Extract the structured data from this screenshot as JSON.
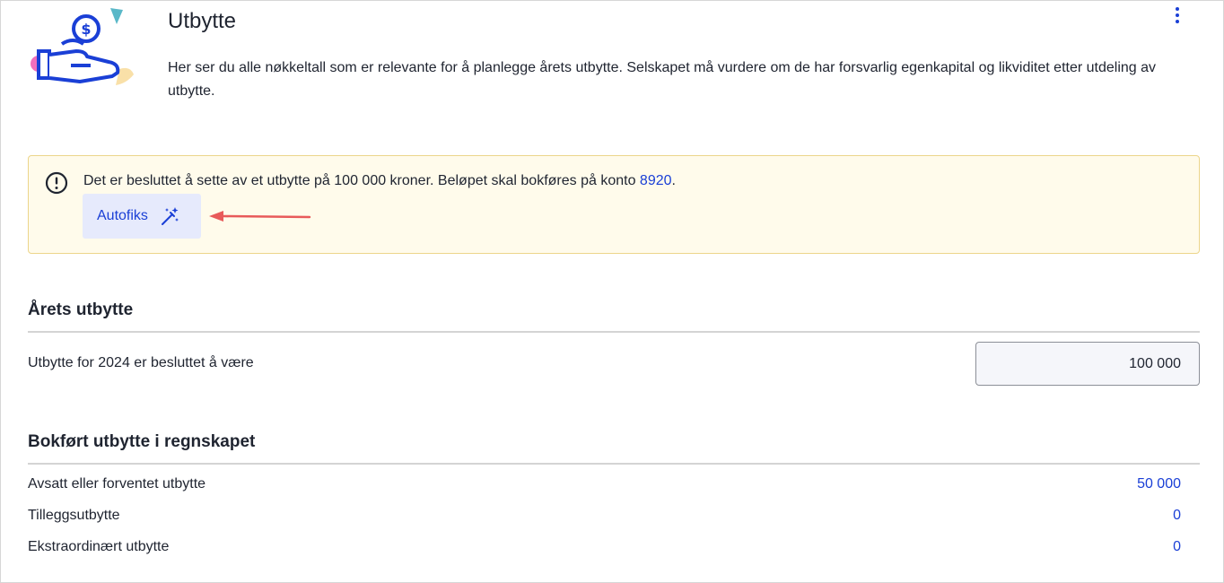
{
  "header": {
    "title": "Utbytte",
    "description": "Her ser du alle nøkkeltall som er relevante for å planlegge årets utbytte. Selskapet må vurdere om de har forsvarlig egenkapital og likviditet etter utdeling av utbytte."
  },
  "alert": {
    "text": "Det er besluttet å sette av et utbytte på 100 000 kroner. Beløpet skal bokføres på konto ",
    "account_link": "8920",
    "text_end": ".",
    "button_label": "Autofiks"
  },
  "arets_utbytte": {
    "title": "Årets utbytte",
    "row_label": "Utbytte for 2024 er besluttet å være",
    "input_value": "100 000"
  },
  "bokfort": {
    "title": "Bokført utbytte i regnskapet",
    "rows": [
      {
        "label": "Avsatt eller forventet utbytte",
        "value": "50 000"
      },
      {
        "label": "Tilleggsutbytte",
        "value": "0"
      },
      {
        "label": "Ekstraordinært utbytte",
        "value": "0"
      }
    ]
  },
  "colors": {
    "accent": "#1a3fd6",
    "alert_bg": "#fffbeb",
    "alert_border": "#ecd58b",
    "annotation_arrow": "#e85a5a"
  },
  "icons": [
    "dividend-illustration",
    "more-vertical-icon",
    "exclamation-circle-icon",
    "magic-wand-icon",
    "annotation-arrow"
  ]
}
